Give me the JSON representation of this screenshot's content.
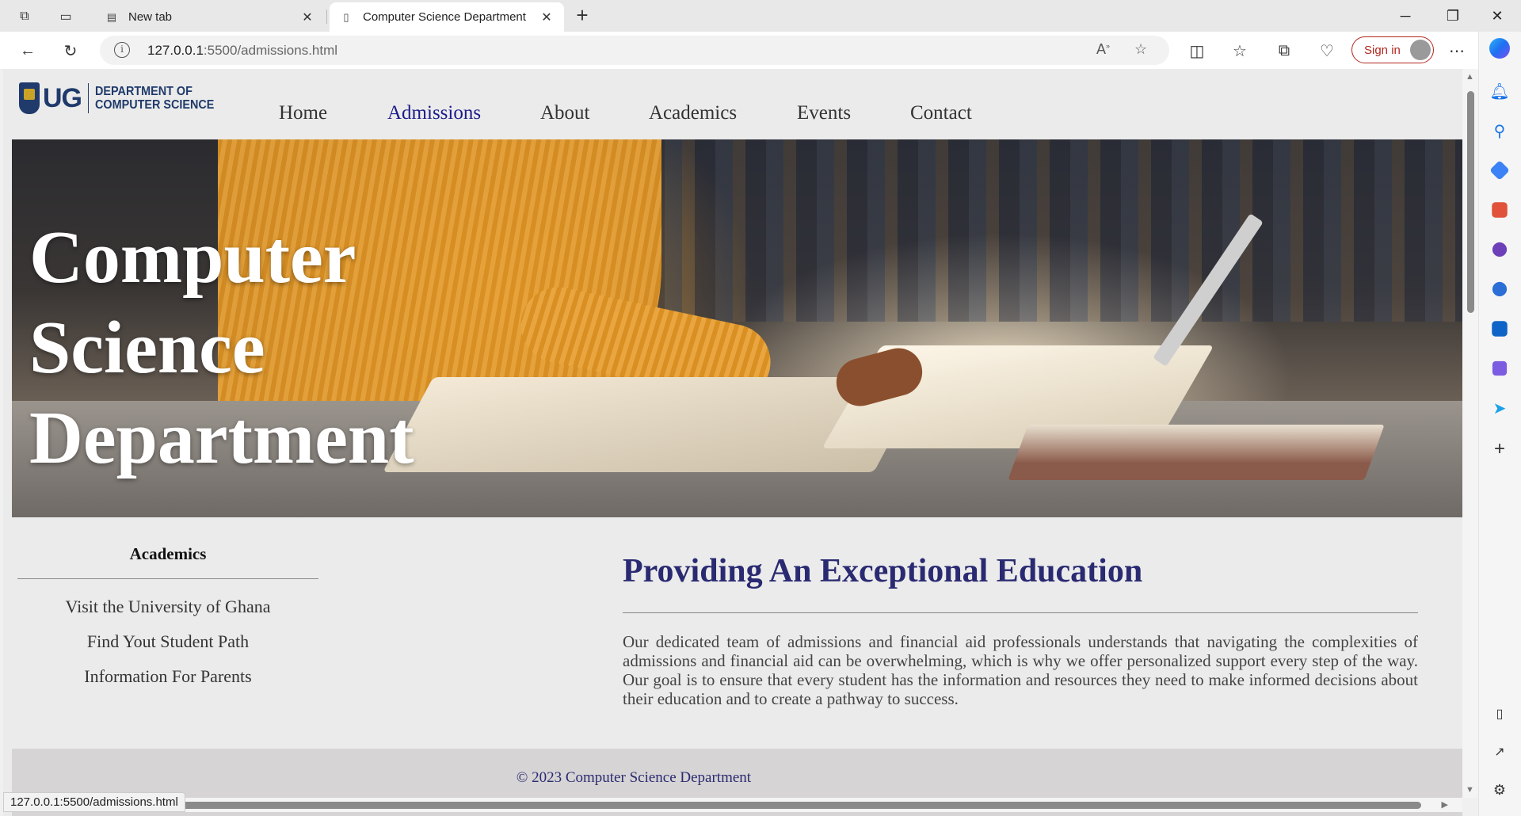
{
  "browser": {
    "tabs": [
      {
        "label": "New tab",
        "active": false
      },
      {
        "label": "Computer Science Department",
        "active": true
      }
    ],
    "url_host": "127.0.0.1",
    "url_path": ":5500/admissions.html",
    "signin_label": "Sign in",
    "status_url": "127.0.0.1:5500/admissions.html"
  },
  "site": {
    "logo": {
      "mark": "UG",
      "line1": "DEPARTMENT OF",
      "line2": "COMPUTER SCIENCE"
    },
    "nav": [
      {
        "label": "Home",
        "current": false
      },
      {
        "label": "Admissions",
        "current": true
      },
      {
        "label": "About",
        "current": false
      },
      {
        "label": "Academics",
        "current": false
      },
      {
        "label": "Events",
        "current": false
      },
      {
        "label": "Contact",
        "current": false
      }
    ],
    "hero": {
      "line1": "Computer",
      "line2": "Science",
      "line3": "Department"
    },
    "sidebar": {
      "heading": "Academics",
      "links": [
        "Visit the University of Ghana",
        "Find Yout Student Path",
        "Information For Parents"
      ]
    },
    "main": {
      "heading": "Providing An Exceptional Education",
      "body": "Our dedicated team of admissions and financial aid professionals understands that navigating the complexities of admissions and financial aid can be overwhelming, which is why we offer personalized support every step of the way. Our goal is to ensure that every student has the information and resources they need to make informed decisions about their education and to create a pathway to success."
    },
    "footer": {
      "copyright": "© 2023 Computer Science Department"
    }
  },
  "colors": {
    "nav_current": "#1b1b8a",
    "heading": "#2a2a72",
    "brand": "#1f3a6b",
    "signin": "#b3261e"
  }
}
